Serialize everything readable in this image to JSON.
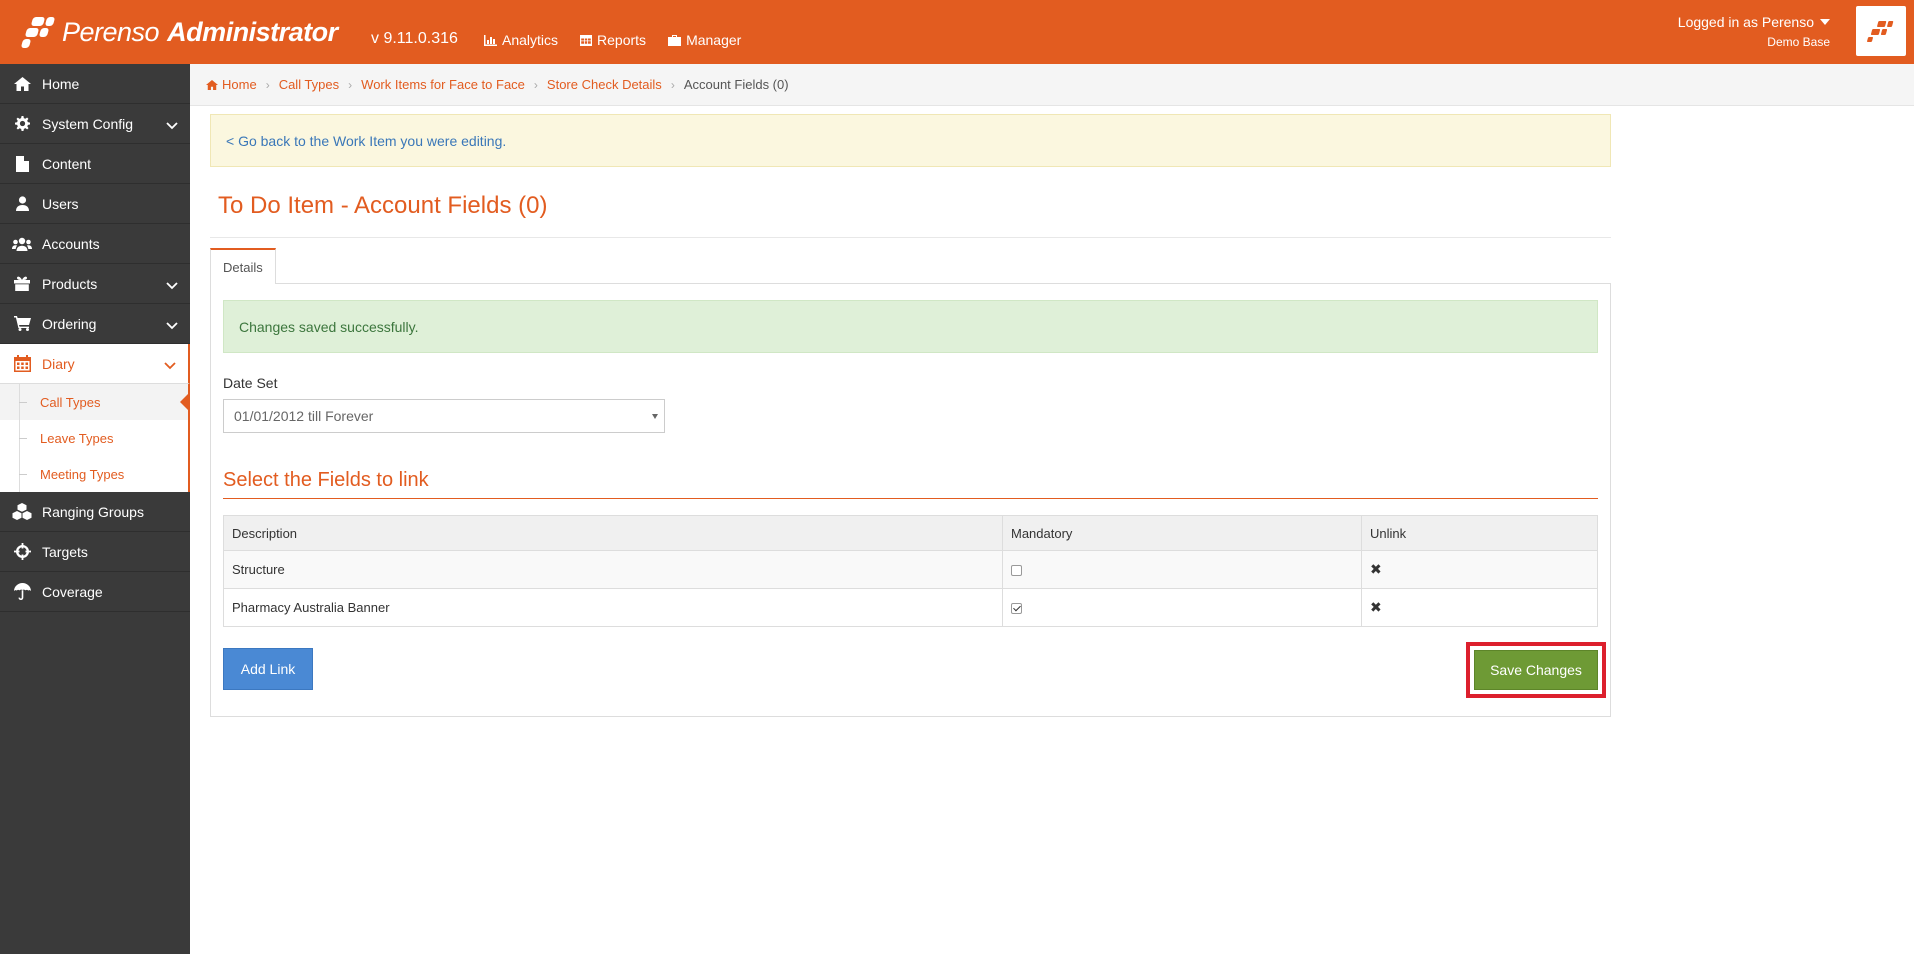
{
  "app": {
    "logo_text_1": "Perenso",
    "logo_text_2": "Administrator",
    "version": "v 9.11.0.316",
    "brand_color": "#e25c20"
  },
  "topnav": [
    {
      "label": "Analytics",
      "icon": "bar-chart-icon"
    },
    {
      "label": "Reports",
      "icon": "table-icon"
    },
    {
      "label": "Manager",
      "icon": "briefcase-icon"
    }
  ],
  "user": {
    "logged_in_as": "Logged in as Perenso",
    "base": "Demo Base"
  },
  "sidebar": {
    "items": [
      {
        "label": "Home",
        "icon": "home-icon"
      },
      {
        "label": "System Config",
        "icon": "gear-icon",
        "expandable": true
      },
      {
        "label": "Content",
        "icon": "file-icon"
      },
      {
        "label": "Users",
        "icon": "user-icon"
      },
      {
        "label": "Accounts",
        "icon": "users-icon"
      },
      {
        "label": "Products",
        "icon": "gift-icon",
        "expandable": true
      },
      {
        "label": "Ordering",
        "icon": "cart-icon",
        "expandable": true
      },
      {
        "label": "Diary",
        "icon": "calendar-icon",
        "expandable": true,
        "active": true
      },
      {
        "label": "Ranging Groups",
        "icon": "cubes-icon"
      },
      {
        "label": "Targets",
        "icon": "crosshairs-icon"
      },
      {
        "label": "Coverage",
        "icon": "umbrella-icon"
      }
    ],
    "diary_sub": [
      {
        "label": "Call Types",
        "current": true
      },
      {
        "label": "Leave Types"
      },
      {
        "label": "Meeting Types"
      }
    ]
  },
  "breadcrumb": {
    "items": [
      "Home",
      "Call Types",
      "Work Items for Face to Face",
      "Store Check Details"
    ],
    "current": "Account Fields (0)"
  },
  "back_link": "< Go back to the Work Item you were editing.",
  "page_title": "To Do Item - Account Fields (0)",
  "tabs": [
    "Details"
  ],
  "alert": "Changes saved successfully.",
  "date_set": {
    "label": "Date Set",
    "value": "01/01/2012 till Forever"
  },
  "section_title": "Select the Fields to link",
  "table": {
    "columns": [
      "Description",
      "Mandatory",
      "Unlink"
    ],
    "rows": [
      {
        "description": "Structure",
        "mandatory": false
      },
      {
        "description": "Pharmacy Australia Banner",
        "mandatory": true
      }
    ]
  },
  "buttons": {
    "add_link": "Add Link",
    "save_changes": "Save Changes"
  }
}
